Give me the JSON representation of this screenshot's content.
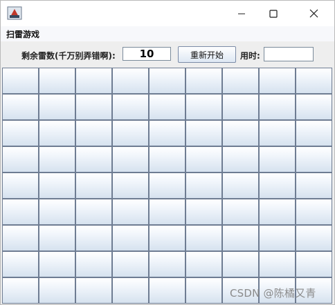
{
  "window": {
    "menu": [
      "扫雷游戏"
    ]
  },
  "controls": {
    "mines_label": "剩余雷数(千万别弄错啊):",
    "mines_value": "10",
    "restart_label": "重新开始",
    "time_label": "用时:",
    "time_value": ""
  },
  "grid": {
    "rows": 9,
    "cols": 9
  },
  "watermark": "CSDN @陈橘又青"
}
